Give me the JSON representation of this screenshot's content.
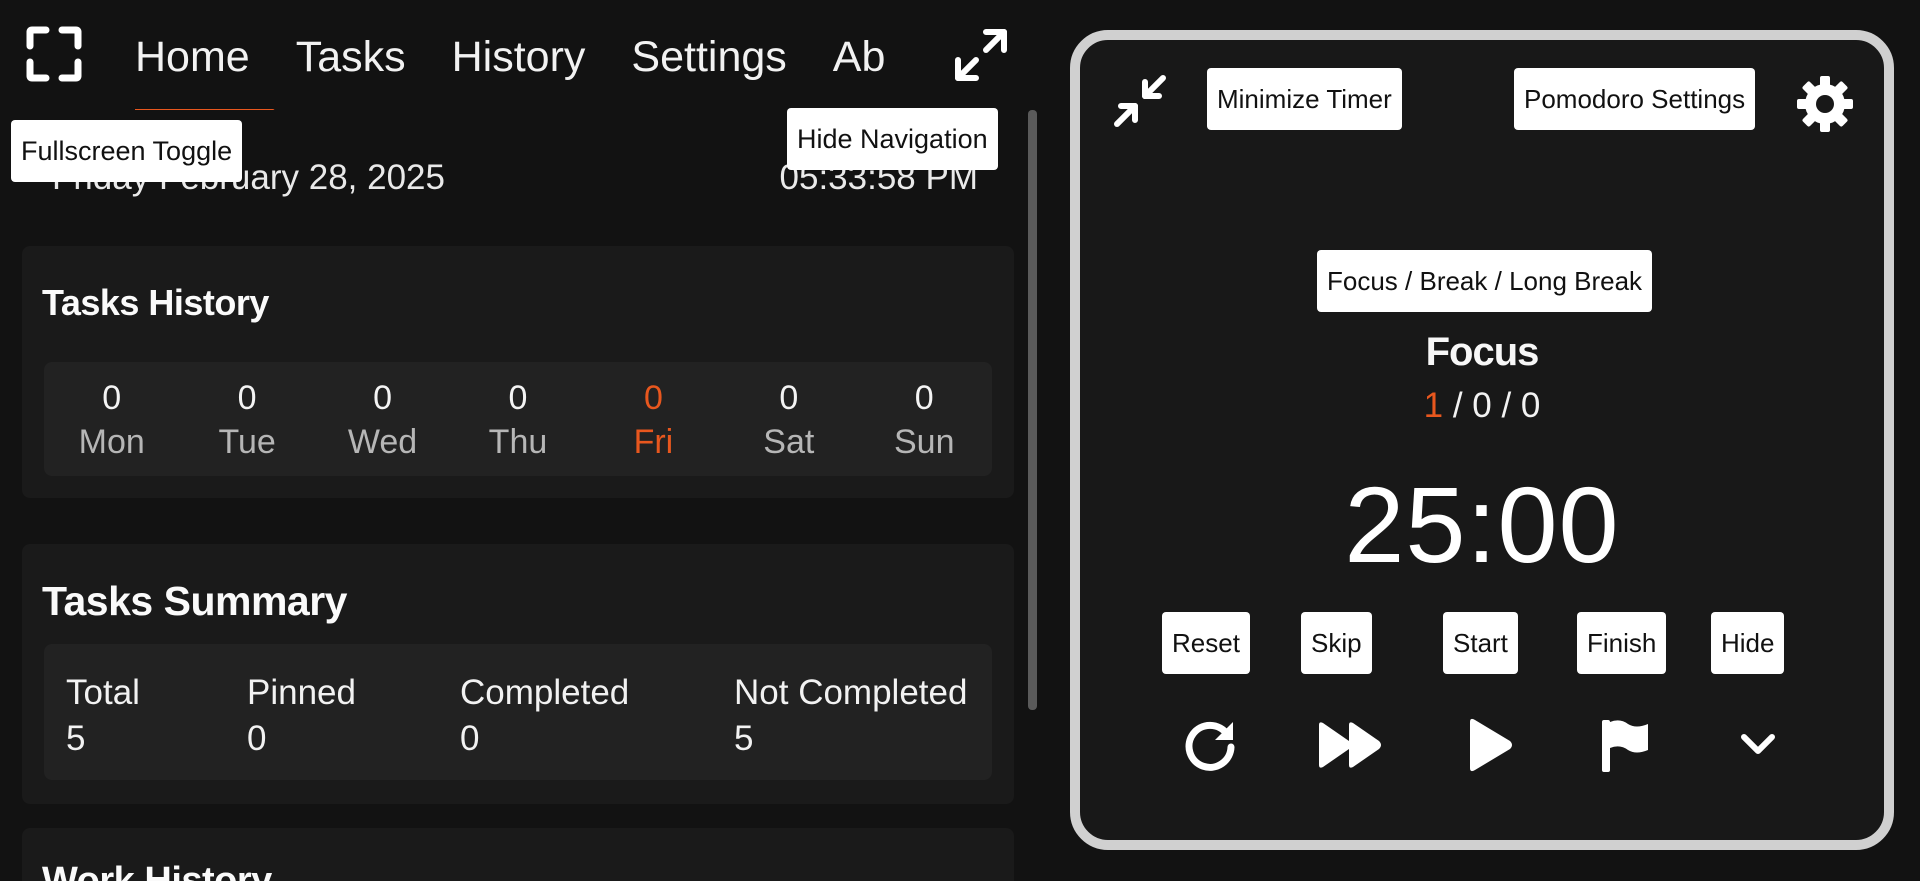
{
  "nav": {
    "tabs": [
      "Home",
      "Tasks",
      "History",
      "Settings",
      "Ab"
    ],
    "active_tab": "Home",
    "fullscreen_tooltip": "Fullscreen Toggle",
    "hide_nav_tooltip": "Hide Navigation"
  },
  "header": {
    "date": "Friday  February 28, 2025",
    "time": "05:33:58 PM"
  },
  "tasks_history": {
    "title": "Tasks History",
    "days": [
      {
        "count": "0",
        "name": "Mon",
        "today": false
      },
      {
        "count": "0",
        "name": "Tue",
        "today": false
      },
      {
        "count": "0",
        "name": "Wed",
        "today": false
      },
      {
        "count": "0",
        "name": "Thu",
        "today": false
      },
      {
        "count": "0",
        "name": "Fri",
        "today": true
      },
      {
        "count": "0",
        "name": "Sat",
        "today": false
      },
      {
        "count": "0",
        "name": "Sun",
        "today": false
      }
    ]
  },
  "tasks_summary": {
    "title": "Tasks Summary",
    "items": [
      {
        "label": "Total",
        "value": "5"
      },
      {
        "label": "Pinned",
        "value": "0"
      },
      {
        "label": "Completed",
        "value": "0"
      },
      {
        "label": "Not Completed",
        "value": "5"
      }
    ]
  },
  "work_history": {
    "title": "Work History"
  },
  "timer": {
    "minimize_tooltip": "Minimize Timer",
    "settings_tooltip": "Pomodoro Settings",
    "mode_tooltip": "Focus / Break / Long Break",
    "mode": "Focus",
    "cycle_current": "1",
    "cycle_rest": " / 0 / 0",
    "time": "25:00",
    "controls": {
      "reset": "Reset",
      "skip": "Skip",
      "start": "Start",
      "finish": "Finish",
      "hide": "Hide"
    }
  },
  "colors": {
    "accent": "#e8571e",
    "background": "#121212",
    "card": "#1a1a1a",
    "timer_border": "#d0d0d0"
  },
  "icons": [
    "fullscreen-icon",
    "expand-icon",
    "minimize-icon",
    "gear-icon",
    "reset-icon",
    "skip-icon",
    "play-icon",
    "flag-icon",
    "chevron-down-icon"
  ]
}
